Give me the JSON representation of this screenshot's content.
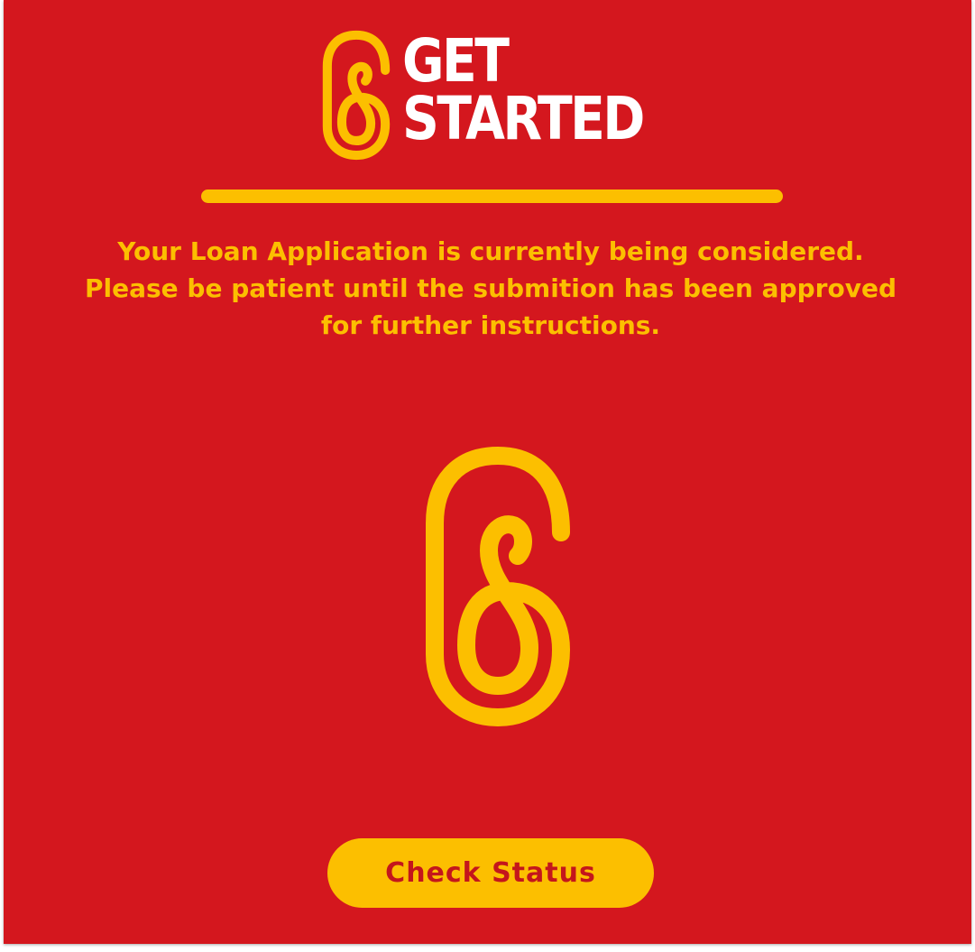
{
  "header": {
    "logo_icon": "infinity-loop-logo-icon",
    "title_line1": "GET",
    "title_line2": "STARTED"
  },
  "message": {
    "line1": "Your Loan Application is currently being considered.",
    "line2": "Please be patient until the submition has been approved",
    "line3": "for further instructions."
  },
  "center_logo": {
    "icon": "infinity-loop-logo-icon"
  },
  "actions": {
    "check_status_label": "Check Status"
  },
  "colors": {
    "background": "#d4171e",
    "accent": "#fcbf00",
    "title_text": "#ffffff",
    "button_text": "#c4161c"
  }
}
